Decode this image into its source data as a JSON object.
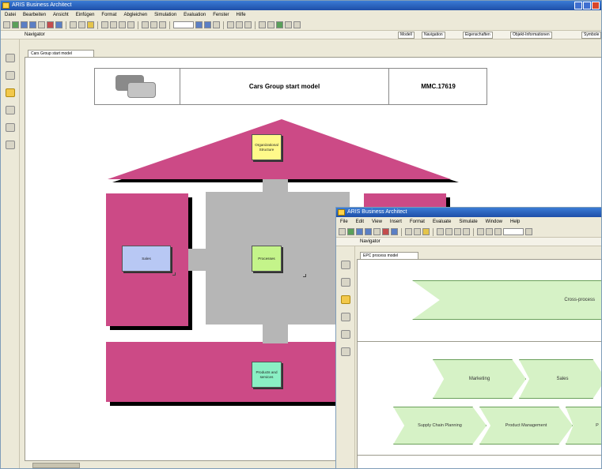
{
  "main_window": {
    "title": "ARIS Business Architect",
    "menu": [
      "Datei",
      "Bearbeiten",
      "Ansicht",
      "Einfügen",
      "Format",
      "Abgleichen",
      "Simulation",
      "Evaluation",
      "Fenster",
      "Hilfe"
    ],
    "explorer_label": "Navigator",
    "nav_buttons": [
      "Modell",
      "Navigation",
      "Eigenschaften",
      "Objekt-Informationen",
      "Symbole"
    ],
    "model_tab": "Cars Group start model",
    "header_title": "Cars Group start model",
    "header_code": "MMC.17619",
    "boxes": {
      "top": "Organizational Structure",
      "left": "Sales",
      "center": "Processes",
      "bottom": "Products and services"
    },
    "colors": {
      "magenta": "#cc4a86",
      "gray": "#b6b6b6",
      "yellow": "#fff98a",
      "blue": "#b8c8f4",
      "green": "#c4f48a",
      "teal": "#8af0c4"
    }
  },
  "front_window": {
    "title": "ARIS Business Architect",
    "menu": [
      "File",
      "Edit",
      "View",
      "Insert",
      "Format",
      "Evaluate",
      "Simulate",
      "Window",
      "Help"
    ],
    "explorer_label": "Navigator",
    "model_tab": "EPC process model",
    "big_chevron": "Cross-process",
    "chevrons_row1": [
      "Marketing",
      "Sales"
    ],
    "chevrons_row2": [
      "Supply Chain Planning",
      "Product Management",
      "P"
    ]
  }
}
